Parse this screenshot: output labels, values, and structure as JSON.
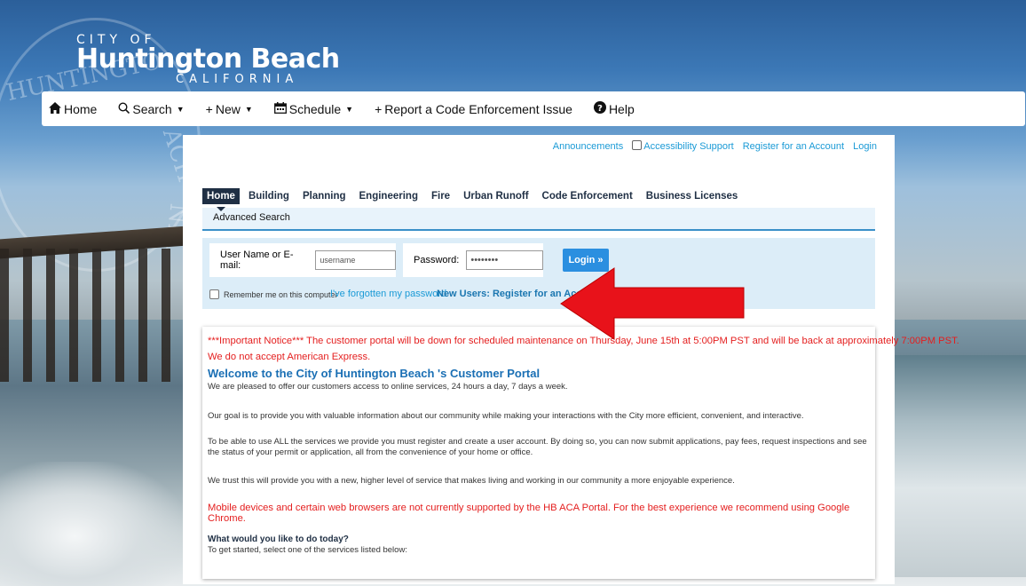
{
  "logo": {
    "city": "CITY OF",
    "name": "Huntington Beach",
    "state": "CALIFORNIA"
  },
  "seal_text": {
    "left": "HUNTINGTO",
    "right": "ACH",
    "right2": "NIA"
  },
  "nav": [
    {
      "label": "Home",
      "icon": "home-icon"
    },
    {
      "label": "Search",
      "icon": "search-icon",
      "dropdown": true
    },
    {
      "label": "New",
      "icon": "plus-icon",
      "dropdown": true
    },
    {
      "label": "Schedule",
      "icon": "calendar-icon",
      "dropdown": true
    },
    {
      "label": "Report a Code Enforcement Issue",
      "icon": "plus-icon"
    },
    {
      "label": "Help",
      "icon": "help-icon"
    }
  ],
  "toplinks": {
    "announcements": "Announcements",
    "accessibility": "Accessibility Support",
    "register": "Register for an Account",
    "login": "Login"
  },
  "tabs": [
    "Home",
    "Building",
    "Planning",
    "Engineering",
    "Fire",
    "Urban Runoff",
    "Code Enforcement",
    "Business Licenses"
  ],
  "active_tab": "Home",
  "subnav": "Advanced Search",
  "login": {
    "username_label": "User Name or E-mail:",
    "username_placeholder": "username",
    "password_label": "Password:",
    "password_value": "••••••••",
    "button": "Login »",
    "remember": "Remember me on this computer",
    "forgot": "I've forgotten my password",
    "new_users_prefix": "New Users:",
    "new_users_link": "Register for an Account"
  },
  "notice": {
    "line1": "***Important Notice*** The customer portal will be down for scheduled maintenance on Thursday, June 15th at 5:00PM PST and will be back at approximately 7:00PM PST.",
    "line2": "We do not accept American Express.",
    "welcome": "Welcome to the City of Huntington Beach 's Customer Portal",
    "p1": "We are pleased to offer our customers access to online services, 24 hours a day, 7 days a week.",
    "p2": "Our goal is to provide you with valuable information about our community while making your interactions with the City more efficient, convenient, and interactive.",
    "p3": "To be able to use ALL the services we provide you must register and create a user account. By doing so, you can now submit applications, pay fees, request inspections and see the status of your permit or application, all from the convenience of your home or office.",
    "p4": "We trust this will provide you with a new, higher level of service that makes living and working in our community a more enjoyable experience.",
    "mobile": "Mobile devices and certain web browsers are not currently supported by the HB ACA Portal. For the best experience we recommend using Google Chrome.",
    "todo_heading": "What would you like to do today?",
    "todo_text": "To get started, select one of the services listed below:"
  },
  "colors": {
    "accent": "#1a9ad6",
    "alert": "#e41e1e",
    "tab_active": "#1f2f44",
    "arrow": "#e8121a"
  }
}
